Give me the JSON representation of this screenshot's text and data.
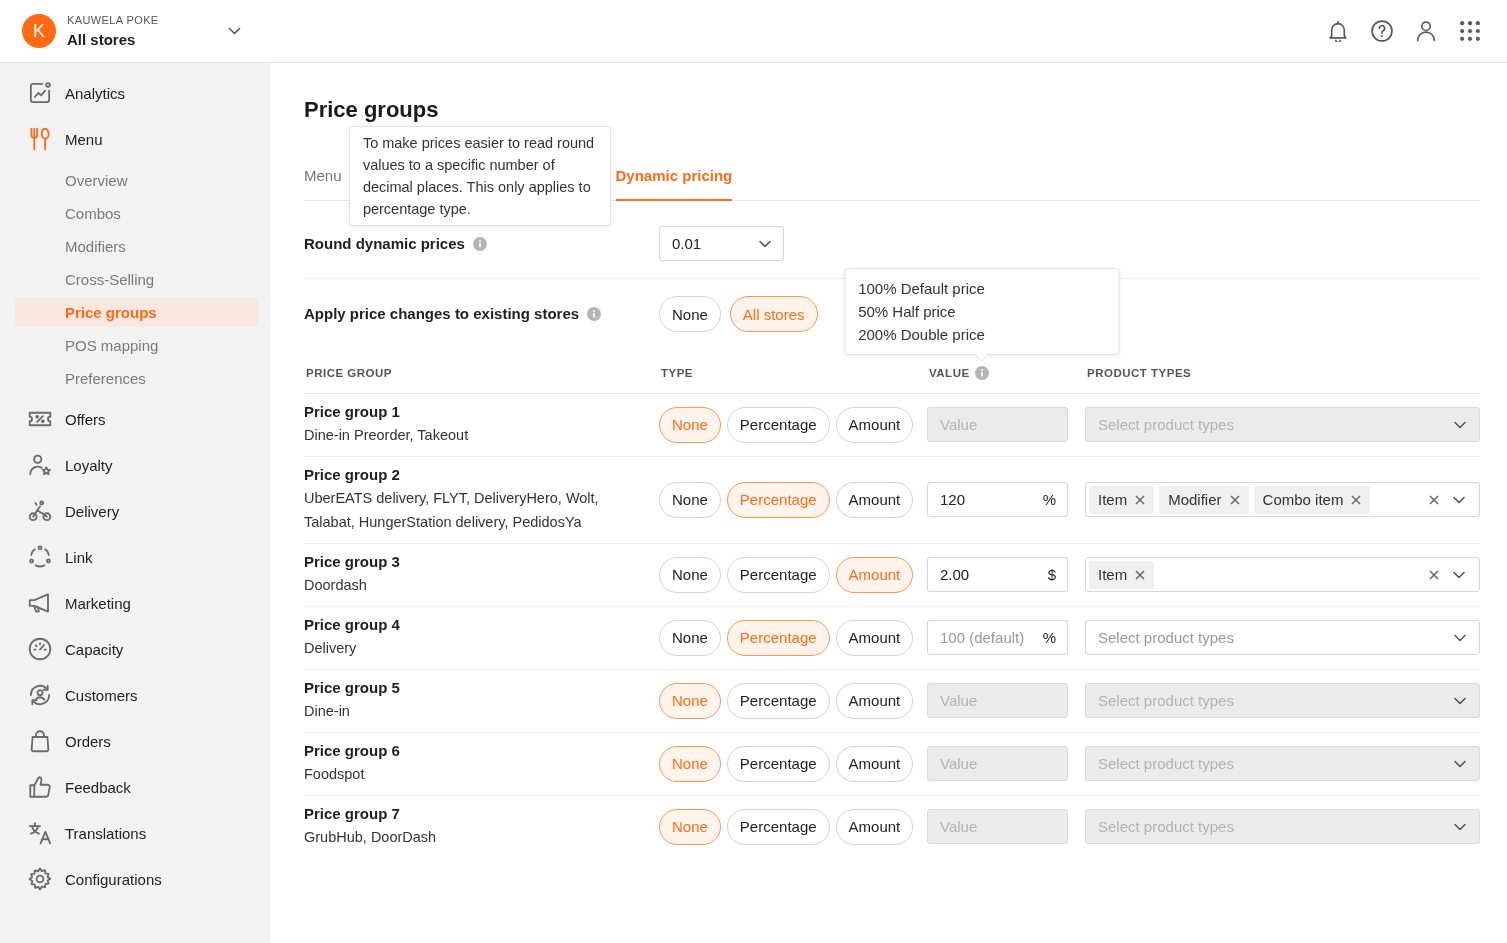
{
  "header": {
    "avatar": "K",
    "brand": "KAUWELA POKE",
    "store": "All stores"
  },
  "sidebar": {
    "items": [
      {
        "label": "Analytics",
        "selected": false
      },
      {
        "label": "Menu",
        "selected": true,
        "children": [
          {
            "label": "Overview",
            "selected": false
          },
          {
            "label": "Combos",
            "selected": false
          },
          {
            "label": "Modifiers",
            "selected": false
          },
          {
            "label": "Cross-Selling",
            "selected": false
          },
          {
            "label": "Price groups",
            "selected": true
          },
          {
            "label": "POS mapping",
            "selected": false
          },
          {
            "label": "Preferences",
            "selected": false
          }
        ]
      },
      {
        "label": "Offers",
        "selected": false
      },
      {
        "label": "Loyalty",
        "selected": false
      },
      {
        "label": "Delivery",
        "selected": false
      },
      {
        "label": "Link",
        "selected": false
      },
      {
        "label": "Marketing",
        "selected": false
      },
      {
        "label": "Capacity",
        "selected": false
      },
      {
        "label": "Customers",
        "selected": false
      },
      {
        "label": "Orders",
        "selected": false
      },
      {
        "label": "Feedback",
        "selected": false
      },
      {
        "label": "Translations",
        "selected": false
      },
      {
        "label": "Configurations",
        "selected": false
      }
    ]
  },
  "page": {
    "title": "Price groups",
    "tabs": [
      {
        "label": "Menu",
        "selected": false
      },
      {
        "label": "Dynamic pricing",
        "selected": true
      }
    ]
  },
  "settings": [
    {
      "kind": "select",
      "label": "Round dynamic prices",
      "info": true,
      "tooltip": "To make prices easier to read round values to a specific number of decimal places. This only applies to percentage type.",
      "value": "0.01"
    },
    {
      "kind": "options",
      "label": "Apply price changes to existing stores",
      "info": true,
      "options": [
        {
          "label": "None",
          "selected": false
        },
        {
          "label": "All stores",
          "selected": true
        }
      ]
    }
  ],
  "table": {
    "columns": [
      {
        "label": "PRICE GROUP",
        "info": false
      },
      {
        "label": "TYPE",
        "info": false
      },
      {
        "label": "VALUE",
        "info": true,
        "tooltip": [
          "100% Default price",
          "50% Half price",
          "200% Double price"
        ]
      },
      {
        "label": "PRODUCT TYPES",
        "info": false
      }
    ],
    "rows": [
      {
        "name": "Price group 1",
        "channels": "Dine-in Preorder, Takeout",
        "types": [
          {
            "label": "None",
            "selected": true
          },
          {
            "label": "Percentage",
            "selected": false
          },
          {
            "label": "Amount",
            "selected": false
          }
        ],
        "value": {
          "placeholder": "Value",
          "disabled": true
        },
        "product_types": {
          "placeholder": "Select product types",
          "disabled": true
        }
      },
      {
        "name": "Price group 2",
        "channels": "UberEATS delivery, FLYT, DeliveryHero, Wolt, Talabat, HungerStation delivery, PedidosYa",
        "types": [
          {
            "label": "None",
            "selected": false
          },
          {
            "label": "Percentage",
            "selected": true
          },
          {
            "label": "Amount",
            "selected": false
          }
        ],
        "value": {
          "value": "120",
          "unit": "%",
          "disabled": false
        },
        "product_types": {
          "tags": [
            "Item",
            "Modifier",
            "Combo item"
          ],
          "disabled": false
        }
      },
      {
        "name": "Price group 3",
        "channels": "Doordash",
        "types": [
          {
            "label": "None",
            "selected": false
          },
          {
            "label": "Percentage",
            "selected": false
          },
          {
            "label": "Amount",
            "selected": true
          }
        ],
        "value": {
          "value": "2.00",
          "unit": "$",
          "disabled": false
        },
        "product_types": {
          "tags": [
            "Item"
          ],
          "disabled": false
        }
      },
      {
        "name": "Price group 4",
        "channels": "Delivery",
        "types": [
          {
            "label": "None",
            "selected": false
          },
          {
            "label": "Percentage",
            "selected": true
          },
          {
            "label": "Amount",
            "selected": false
          }
        ],
        "value": {
          "placeholder": "100 (default)",
          "unit": "%",
          "disabled": false
        },
        "product_types": {
          "placeholder": "Select product types",
          "disabled": false
        }
      },
      {
        "name": "Price group 5",
        "channels": "Dine-in",
        "types": [
          {
            "label": "None",
            "selected": true
          },
          {
            "label": "Percentage",
            "selected": false
          },
          {
            "label": "Amount",
            "selected": false
          }
        ],
        "value": {
          "placeholder": "Value",
          "disabled": true
        },
        "product_types": {
          "placeholder": "Select product types",
          "disabled": true
        }
      },
      {
        "name": "Price group 6",
        "channels": "Foodspot",
        "types": [
          {
            "label": "None",
            "selected": true
          },
          {
            "label": "Percentage",
            "selected": false
          },
          {
            "label": "Amount",
            "selected": false
          }
        ],
        "value": {
          "placeholder": "Value",
          "disabled": true
        },
        "product_types": {
          "placeholder": "Select product types",
          "disabled": true
        }
      },
      {
        "name": "Price group 7",
        "channels": "GrubHub, DoorDash",
        "types": [
          {
            "label": "None",
            "selected": true
          },
          {
            "label": "Percentage",
            "selected": false
          },
          {
            "label": "Amount",
            "selected": false
          }
        ],
        "value": {
          "placeholder": "Value",
          "disabled": true
        },
        "product_types": {
          "placeholder": "Select product types",
          "disabled": true
        }
      }
    ]
  }
}
